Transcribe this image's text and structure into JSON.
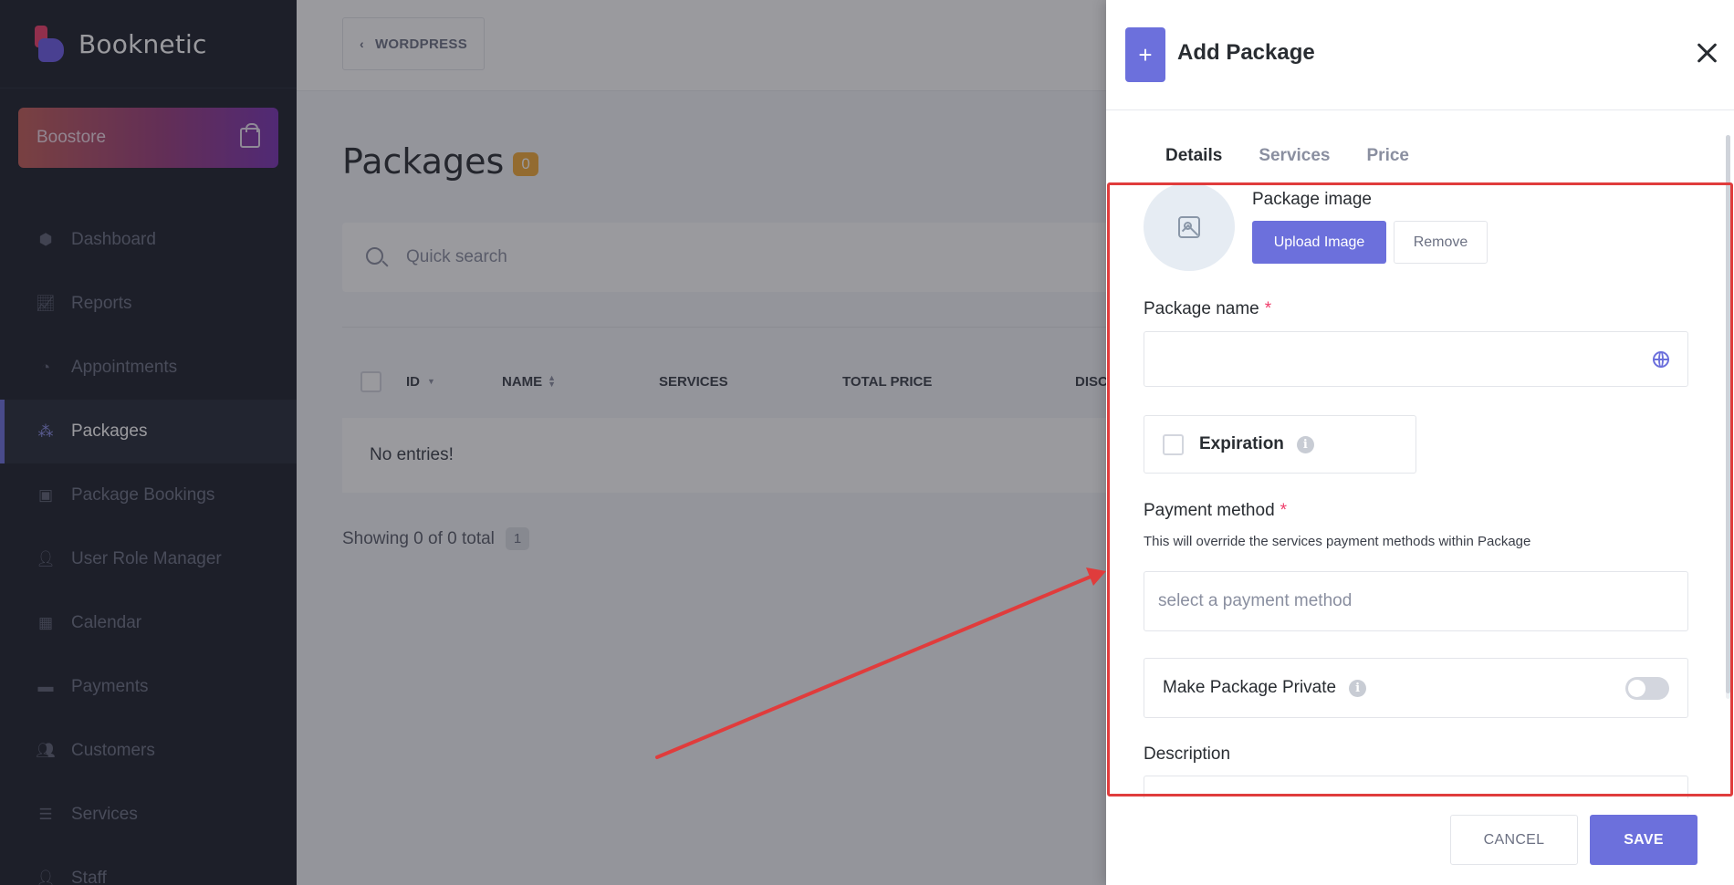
{
  "sidebar": {
    "brand": "Booknetic",
    "boostore_label": "Boostore",
    "items": [
      {
        "label": "Dashboard",
        "icon": "cube-icon"
      },
      {
        "label": "Reports",
        "icon": "chart-icon"
      },
      {
        "label": "Appointments",
        "icon": "clock-icon"
      },
      {
        "label": "Packages",
        "icon": "packages-icon",
        "active": true
      },
      {
        "label": "Package Bookings",
        "icon": "box-icon"
      },
      {
        "label": "User Role Manager",
        "icon": "user-plus-icon"
      },
      {
        "label": "Calendar",
        "icon": "calendar-icon"
      },
      {
        "label": "Payments",
        "icon": "wallet-icon"
      },
      {
        "label": "Customers",
        "icon": "users-icon"
      },
      {
        "label": "Services",
        "icon": "list-icon"
      },
      {
        "label": "Staff",
        "icon": "user-icon"
      }
    ]
  },
  "topbar": {
    "wordpress_label": "WORDPRESS"
  },
  "page": {
    "title": "Packages",
    "count": "0",
    "search_placeholder": "Quick search",
    "columns": [
      "ID",
      "NAME",
      "SERVICES",
      "TOTAL PRICE",
      "DISC"
    ],
    "empty_text": "No entries!",
    "showing_text": "Showing 0 of 0 total",
    "page_number": "1"
  },
  "modal": {
    "title": "Add Package",
    "tabs": [
      "Details",
      "Services",
      "Price"
    ],
    "package_image_label": "Package image",
    "upload_label": "Upload Image",
    "remove_label": "Remove",
    "package_name_label": "Package name",
    "required_mark": "*",
    "expiration_label": "Expiration",
    "payment_method_label": "Payment method",
    "payment_helper": "This will override the services payment methods within Package",
    "payment_placeholder": "select a payment method",
    "private_label": "Make Package Private",
    "description_label": "Description",
    "cancel_label": "CANCEL",
    "save_label": "SAVE"
  },
  "colors": {
    "accent": "#6c70dc",
    "sidebar_bg": "#1c1f2b",
    "badge": "#f2a937",
    "required": "#ef3d6b",
    "annotation": "#e03c3c"
  }
}
